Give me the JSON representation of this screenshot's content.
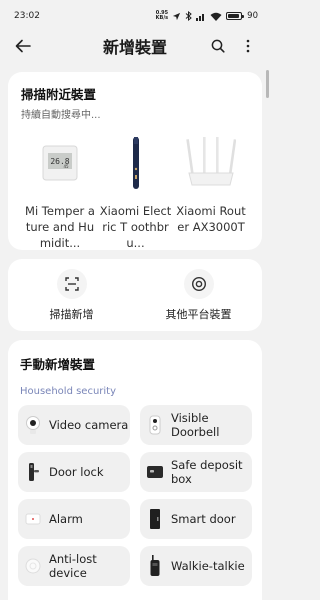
{
  "status": {
    "time": "23:02",
    "speed_value": "0.95",
    "speed_unit": "KB/s",
    "battery": "90",
    "battery_level": 0.9
  },
  "header": {
    "title": "新增裝置",
    "back_icon": "arrow-left-icon",
    "search_icon": "search-icon",
    "more_icon": "more-vertical-icon"
  },
  "scan": {
    "title": "掃描附近裝置",
    "subtitle": "持續自動搜尋中...",
    "devices": [
      {
        "name": "Mi Temperature and Humidity Monitor",
        "display": "Mi Temper ature and Humidit...",
        "icon": "thermometer-display-icon"
      },
      {
        "name": "Xiaomi Electric Toothbrush",
        "display": "Xiaomi Electric T oothbru...",
        "icon": "toothbrush-icon"
      },
      {
        "name": "Xiaomi Router AX3000T",
        "display": "Xiaomi Router AX3000T",
        "icon": "router-icon"
      }
    ]
  },
  "actions": [
    {
      "label": "掃描新增",
      "icon": "scan-icon"
    },
    {
      "label": "其他平台裝置",
      "icon": "target-icon"
    }
  ],
  "manual": {
    "title": "手動新增裝置",
    "category": "Household security",
    "items": [
      {
        "label": "Video camera",
        "icon": "camera-icon"
      },
      {
        "label": "Visible Doorbell",
        "icon": "doorbell-icon"
      },
      {
        "label": "Door lock",
        "icon": "door-lock-icon"
      },
      {
        "label": "Safe deposit box",
        "icon": "safe-box-icon"
      },
      {
        "label": "Alarm",
        "icon": "alarm-icon"
      },
      {
        "label": "Smart door",
        "icon": "smart-door-icon"
      },
      {
        "label": "Anti-lost device",
        "icon": "tracker-icon"
      },
      {
        "label": "Walkie-talkie",
        "icon": "walkie-talkie-icon"
      }
    ]
  }
}
